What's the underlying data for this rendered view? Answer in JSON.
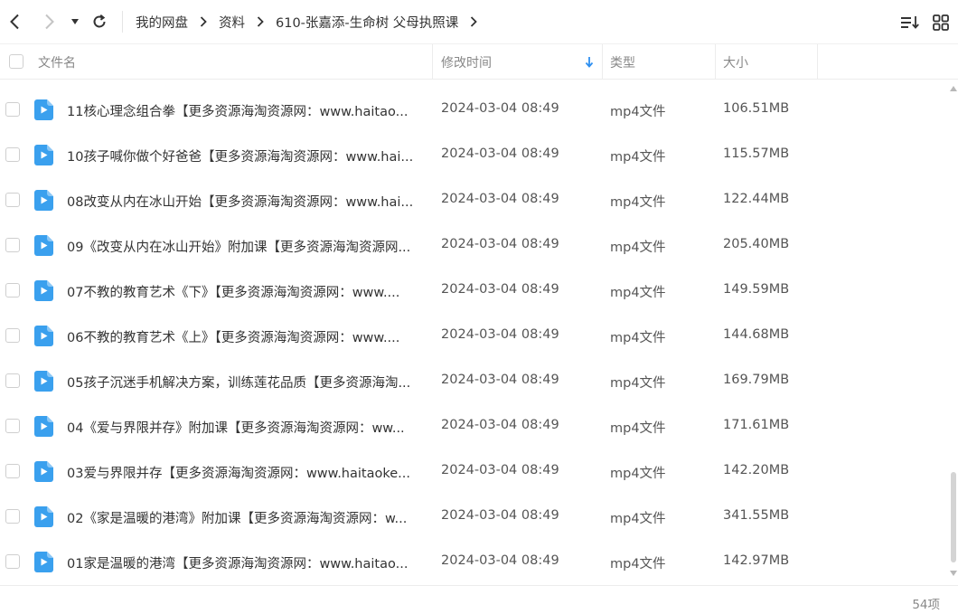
{
  "toolbar": {
    "breadcrumb": [
      "我的网盘",
      "资料",
      "610-张嘉添-生命树 父母执照课"
    ]
  },
  "columns": {
    "name": "文件名",
    "modified": "修改时间",
    "type": "类型",
    "size": "大小"
  },
  "files": [
    {
      "name": "11核心理念组合拳【更多资源海淘资源网：www.haitao...",
      "modified": "2024-03-04 08:49",
      "type": "mp4文件",
      "size": "106.51MB"
    },
    {
      "name": "10孩子喊你做个好爸爸【更多资源海淘资源网：www.hai...",
      "modified": "2024-03-04 08:49",
      "type": "mp4文件",
      "size": "115.57MB"
    },
    {
      "name": "08改变从内在冰山开始【更多资源海淘资源网：www.hai...",
      "modified": "2024-03-04 08:49",
      "type": "mp4文件",
      "size": "122.44MB"
    },
    {
      "name": "09《改变从内在冰山开始》附加课【更多资源海淘资源网...",
      "modified": "2024-03-04 08:49",
      "type": "mp4文件",
      "size": "205.40MB"
    },
    {
      "name": "07不教的教育艺术《下》【更多资源海淘资源网：www....",
      "modified": "2024-03-04 08:49",
      "type": "mp4文件",
      "size": "149.59MB"
    },
    {
      "name": "06不教的教育艺术《上》【更多资源海淘资源网：www....",
      "modified": "2024-03-04 08:49",
      "type": "mp4文件",
      "size": "144.68MB"
    },
    {
      "name": "05孩子沉迷手机解决方案，训练莲花品质【更多资源海淘...",
      "modified": "2024-03-04 08:49",
      "type": "mp4文件",
      "size": "169.79MB"
    },
    {
      "name": "04《爱与界限并存》附加课【更多资源海淘资源网：ww...",
      "modified": "2024-03-04 08:49",
      "type": "mp4文件",
      "size": "171.61MB"
    },
    {
      "name": "03爱与界限并存【更多资源海淘资源网：www.haitaoke...",
      "modified": "2024-03-04 08:49",
      "type": "mp4文件",
      "size": "142.20MB"
    },
    {
      "name": "02《家是温暖的港湾》附加课【更多资源海淘资源网：w...",
      "modified": "2024-03-04 08:49",
      "type": "mp4文件",
      "size": "341.55MB"
    },
    {
      "name": "01家是温暖的港湾【更多资源海淘资源网：www.haitao...",
      "modified": "2024-03-04 08:49",
      "type": "mp4文件",
      "size": "142.97MB"
    }
  ],
  "footer": {
    "item_count": "54项"
  },
  "colors": {
    "accent": "#2e8ff0",
    "file_icon": "#3aa0ee"
  },
  "icons": {
    "back": "chevron-left-icon",
    "forward": "chevron-right-icon",
    "history": "caret-down-icon",
    "refresh": "refresh-icon",
    "sort": "sort-list-icon",
    "grid": "grid-view-icon",
    "file": "video-file-icon"
  }
}
